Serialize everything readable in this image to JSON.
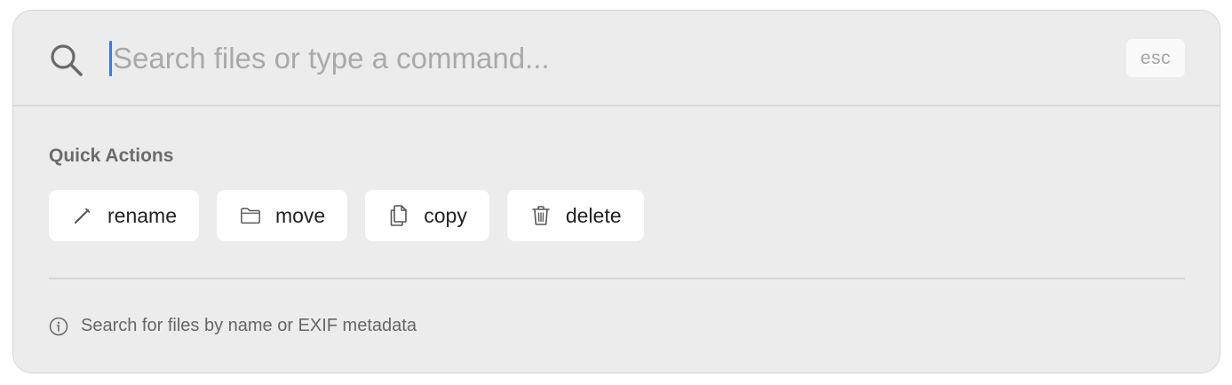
{
  "search": {
    "placeholder": "Search files or type a command...",
    "value": "",
    "icon": "search-icon"
  },
  "esc_key": {
    "label": "esc"
  },
  "quick_actions": {
    "title": "Quick Actions",
    "items": [
      {
        "label": "rename",
        "icon": "pencil-icon"
      },
      {
        "label": "move",
        "icon": "folder-icon"
      },
      {
        "label": "copy",
        "icon": "copy-icon"
      },
      {
        "label": "delete",
        "icon": "trash-icon"
      }
    ]
  },
  "hint": {
    "text": "Search for files by name or EXIF metadata",
    "icon": "info-icon"
  },
  "colors": {
    "background": "#ececec",
    "caret": "#3478f6",
    "button_bg": "#ffffff"
  }
}
